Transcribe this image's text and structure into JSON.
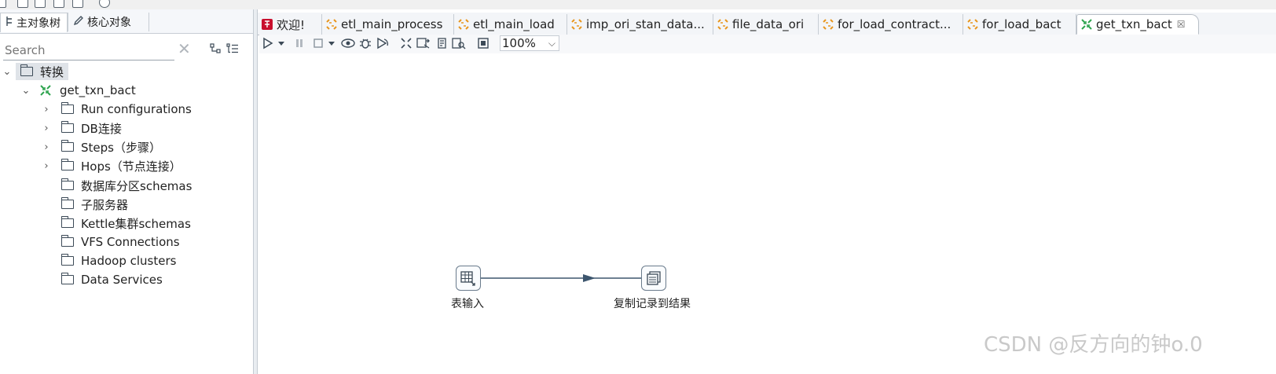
{
  "left_tabs": [
    {
      "label": "主对象树",
      "icon": "tree-icon"
    },
    {
      "label": "核心对象",
      "icon": "pencil-icon"
    }
  ],
  "search": {
    "placeholder": "Search"
  },
  "tree": {
    "root": {
      "label": "转换"
    },
    "transformation": {
      "label": "get_txn_bact"
    },
    "items": [
      {
        "label": "Run configurations",
        "expandable": true
      },
      {
        "label": "DB连接",
        "expandable": true
      },
      {
        "label": "Steps（步骤）",
        "expandable": true
      },
      {
        "label": "Hops（节点连接）",
        "expandable": true
      },
      {
        "label": "数据库分区schemas",
        "expandable": false
      },
      {
        "label": "子服务器",
        "expandable": false
      },
      {
        "label": "Kettle集群schemas",
        "expandable": false
      },
      {
        "label": "VFS Connections",
        "expandable": false
      },
      {
        "label": "Hadoop clusters",
        "expandable": false
      },
      {
        "label": "Data Services",
        "expandable": false
      }
    ]
  },
  "editor_tabs": [
    {
      "label": "欢迎!",
      "icon": "spoon-icon"
    },
    {
      "label": "etl_main_process",
      "icon": "job-icon"
    },
    {
      "label": "etl_main_load",
      "icon": "job-icon"
    },
    {
      "label": "imp_ori_stan_data...",
      "icon": "job-icon"
    },
    {
      "label": "file_data_ori",
      "icon": "job-icon"
    },
    {
      "label": "for_load_contract...",
      "icon": "job-icon"
    },
    {
      "label": "for_load_bact",
      "icon": "job-icon"
    },
    {
      "label": "get_txn_bact",
      "icon": "transformation-icon",
      "active": true,
      "close": "☒"
    }
  ],
  "toolbar": {
    "zoom": "100%"
  },
  "canvas": {
    "steps": [
      {
        "label": "表输入",
        "icon": "table-input-icon"
      },
      {
        "label": "复制记录到结果",
        "icon": "copy-rows-icon"
      }
    ]
  },
  "watermark": "CSDN @反方向的钟o.0",
  "colors": {
    "transformation_green": "#2ea44f",
    "job_orange": "#e8961e",
    "hop_line": "#3d566e"
  }
}
